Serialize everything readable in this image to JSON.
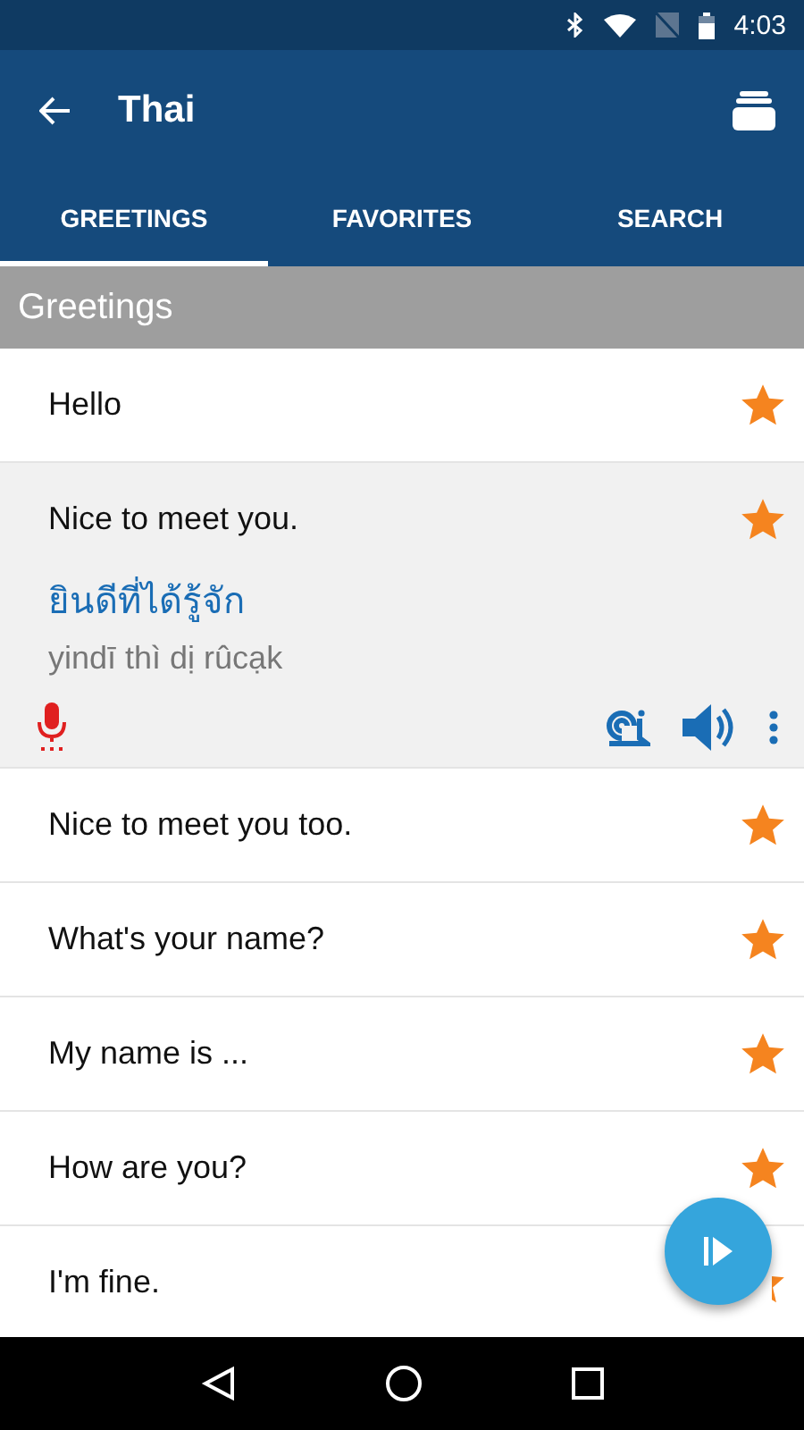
{
  "status_bar": {
    "time": "4:03"
  },
  "app_bar": {
    "title": "Thai"
  },
  "tabs": [
    {
      "label": "GREETINGS",
      "selected": true
    },
    {
      "label": "FAVORITES",
      "selected": false
    },
    {
      "label": "SEARCH",
      "selected": false
    }
  ],
  "section": {
    "title": "Greetings"
  },
  "phrases": [
    {
      "text": "Hello",
      "starred": true,
      "expanded": false
    },
    {
      "text": "Nice to meet you.",
      "starred": true,
      "expanded": true,
      "thai": "ยินดีที่ได้รู้จัก",
      "romanization": "yindī thì dị rûcạk"
    },
    {
      "text": "Nice to meet you too.",
      "starred": true,
      "expanded": false
    },
    {
      "text": "What's your name?",
      "starred": true,
      "expanded": false
    },
    {
      "text": "My name is ...",
      "starred": true,
      "expanded": false
    },
    {
      "text": "How are you?",
      "starred": true,
      "expanded": false
    },
    {
      "text": "I'm fine.",
      "starred": true,
      "expanded": false
    }
  ]
}
